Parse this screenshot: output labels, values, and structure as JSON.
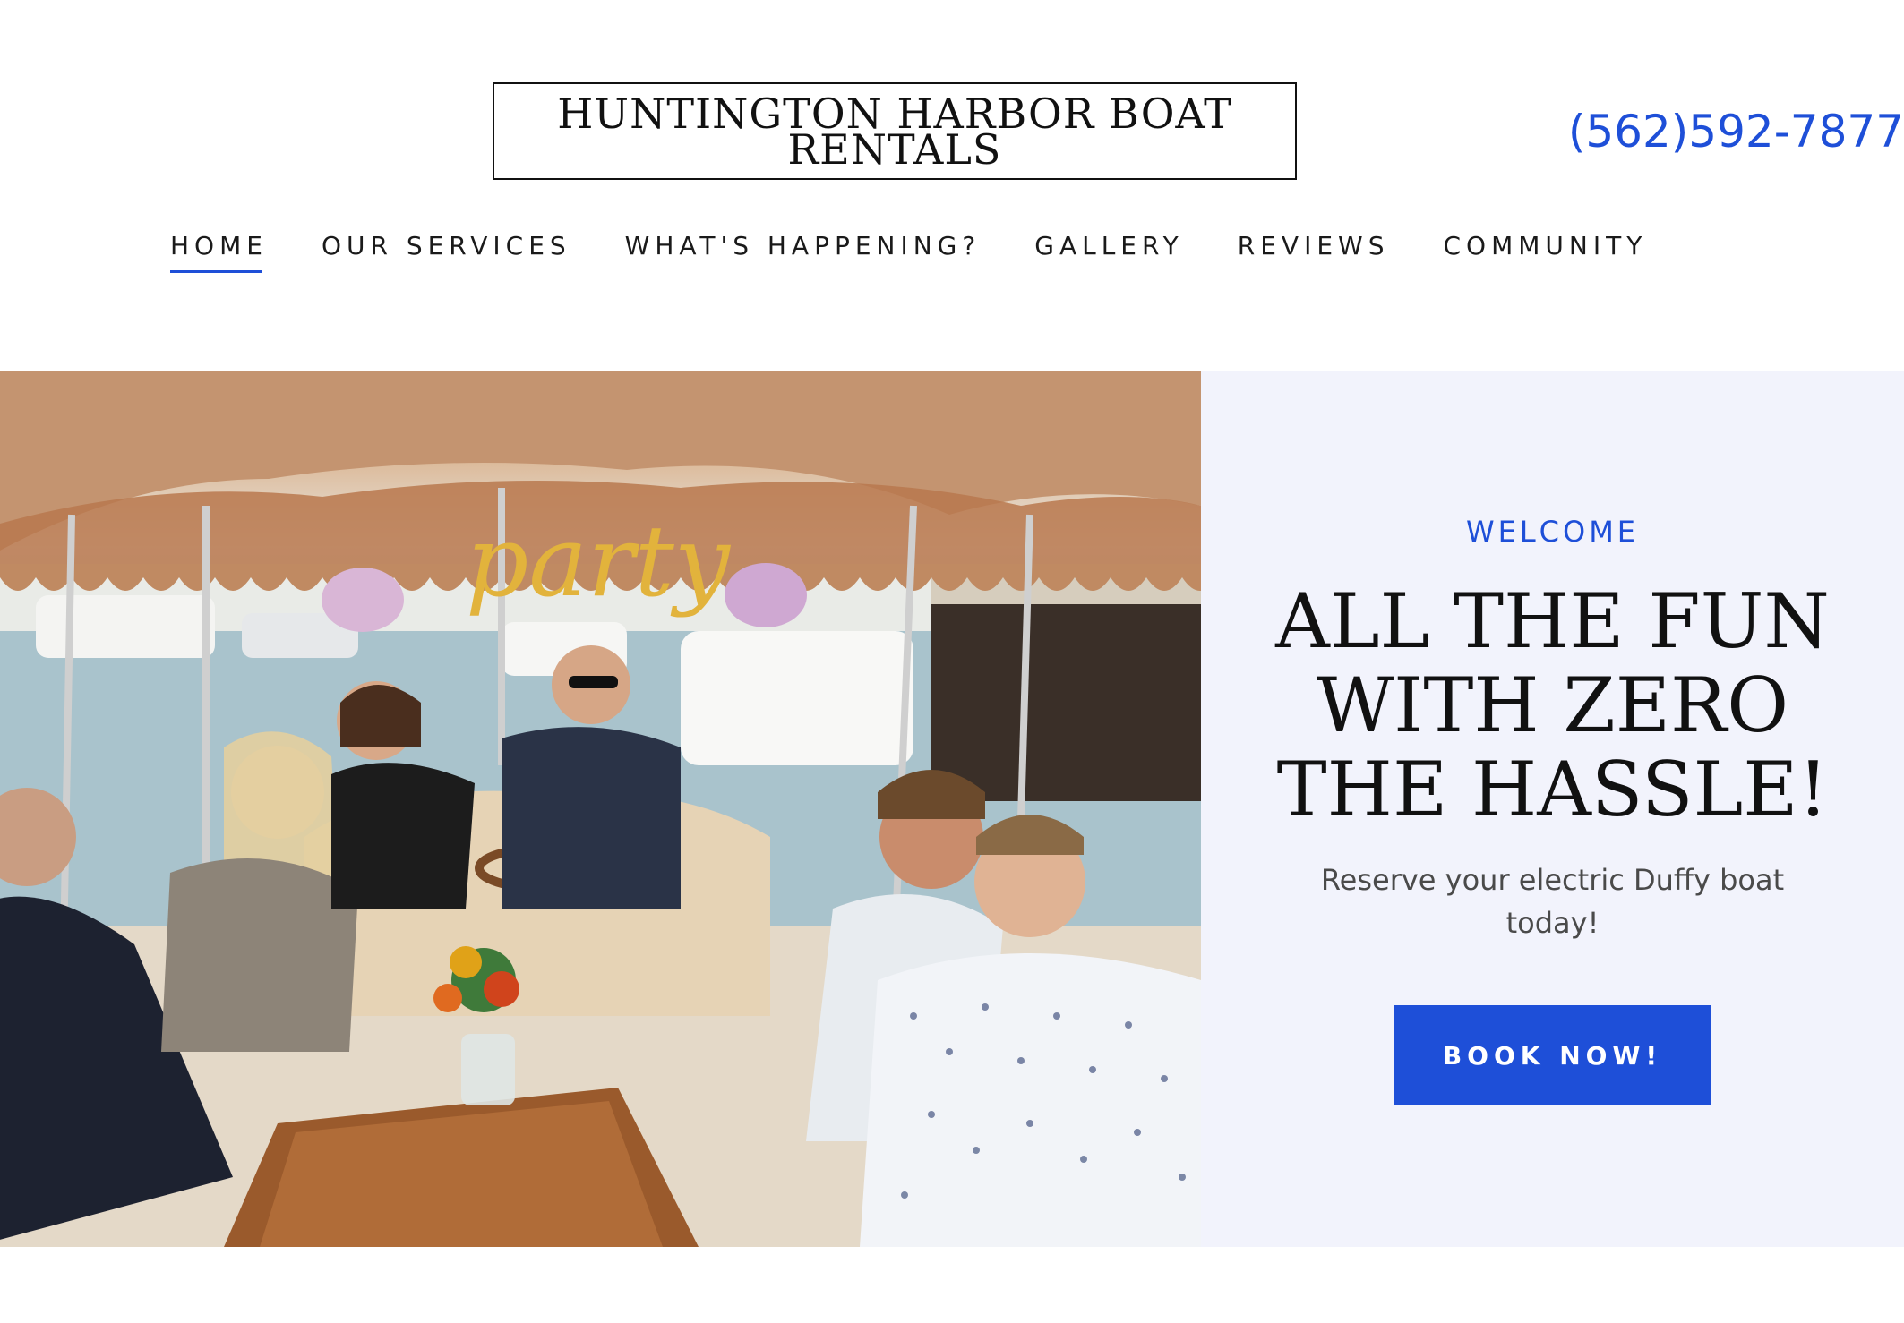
{
  "header": {
    "site_title": "HUNTINGTON HARBOR BOAT RENTALS",
    "phone": "(562)592-7877"
  },
  "nav": {
    "items": [
      {
        "label": "HOME",
        "active": true
      },
      {
        "label": "OUR SERVICES",
        "active": false
      },
      {
        "label": "WHAT'S HAPPENING?",
        "active": false
      },
      {
        "label": "GALLERY",
        "active": false
      },
      {
        "label": "REVIEWS",
        "active": false
      },
      {
        "label": "COMMUNITY",
        "active": false
      }
    ]
  },
  "hero": {
    "image_alt": "Group of friends laughing aboard an electric Duffy boat in the harbor",
    "balloon_text": "party",
    "eyebrow": "WELCOME",
    "headline": "ALL THE FUN WITH ZERO THE HASSLE!",
    "subtext": "Reserve your electric Duffy boat today!",
    "cta_label": "BOOK NOW!"
  },
  "colors": {
    "accent": "#1e4fd8",
    "panel_bg": "#f2f3fc",
    "text": "#111111"
  }
}
